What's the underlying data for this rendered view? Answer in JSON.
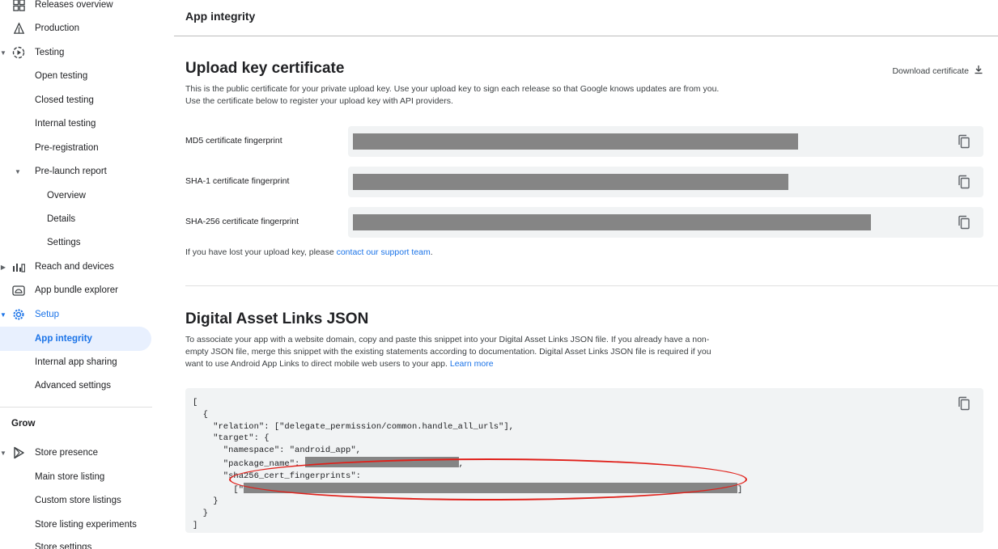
{
  "sidebar": {
    "items": [
      {
        "label": "Releases overview"
      },
      {
        "label": "Production"
      },
      {
        "label": "Testing"
      },
      {
        "label": "Open testing"
      },
      {
        "label": "Closed testing"
      },
      {
        "label": "Internal testing"
      },
      {
        "label": "Pre-registration"
      },
      {
        "label": "Pre-launch report"
      },
      {
        "label": "Overview"
      },
      {
        "label": "Details"
      },
      {
        "label": "Settings"
      },
      {
        "label": "Reach and devices"
      },
      {
        "label": "App bundle explorer"
      },
      {
        "label": "Setup"
      },
      {
        "label": "App integrity"
      },
      {
        "label": "Internal app sharing"
      },
      {
        "label": "Advanced settings"
      }
    ],
    "group_grow": "Grow",
    "grow_items": [
      {
        "label": "Store presence"
      },
      {
        "label": "Main store listing"
      },
      {
        "label": "Custom store listings"
      },
      {
        "label": "Store listing experiments"
      },
      {
        "label": "Store settings"
      }
    ],
    "accent_color": "#1a73e8"
  },
  "main": {
    "page_title": "App integrity",
    "upload_cert": {
      "title": "Upload key certificate",
      "description": "This is the public certificate for your private upload key. Use your upload key to sign each release so that Google knows updates are from you. Use the certificate below to register your upload key with API providers.",
      "download_label": "Download certificate",
      "fingerprints": [
        {
          "label": "MD5 certificate fingerprint"
        },
        {
          "label": "SHA-1 certificate fingerprint"
        },
        {
          "label": "SHA-256 certificate fingerprint"
        }
      ],
      "lost_key_text": "If you have lost your upload key, please ",
      "lost_key_link": "contact our support team",
      "lost_key_end": "."
    },
    "asset_links": {
      "title": "Digital Asset Links JSON",
      "description": "To associate your app with a website domain, copy and paste this snippet into your Digital Asset Links JSON file. If you already have a non-empty JSON file, merge this snippet with the existing statements according to documentation. Digital Asset Links JSON file is required if you want to use Android App Links to direct mobile web users to your app. ",
      "learn_more": "Learn more",
      "code": {
        "l1": "[",
        "l2": "  {",
        "l3": "    \"relation\": [\"delegate_permission/common.handle_all_urls\"],",
        "l4": "    \"target\": {",
        "l5": "      \"namespace\": \"android_app\",",
        "l6a": "      \"package_name\": ",
        "l6b": ",",
        "l7": "      \"sha256_cert_fingerprints\":",
        "l8a": "        [\"",
        "l8b": "]",
        "l9": "    }",
        "l10": "  }",
        "l11": "]"
      }
    },
    "annotation_color": "#e0201a"
  }
}
